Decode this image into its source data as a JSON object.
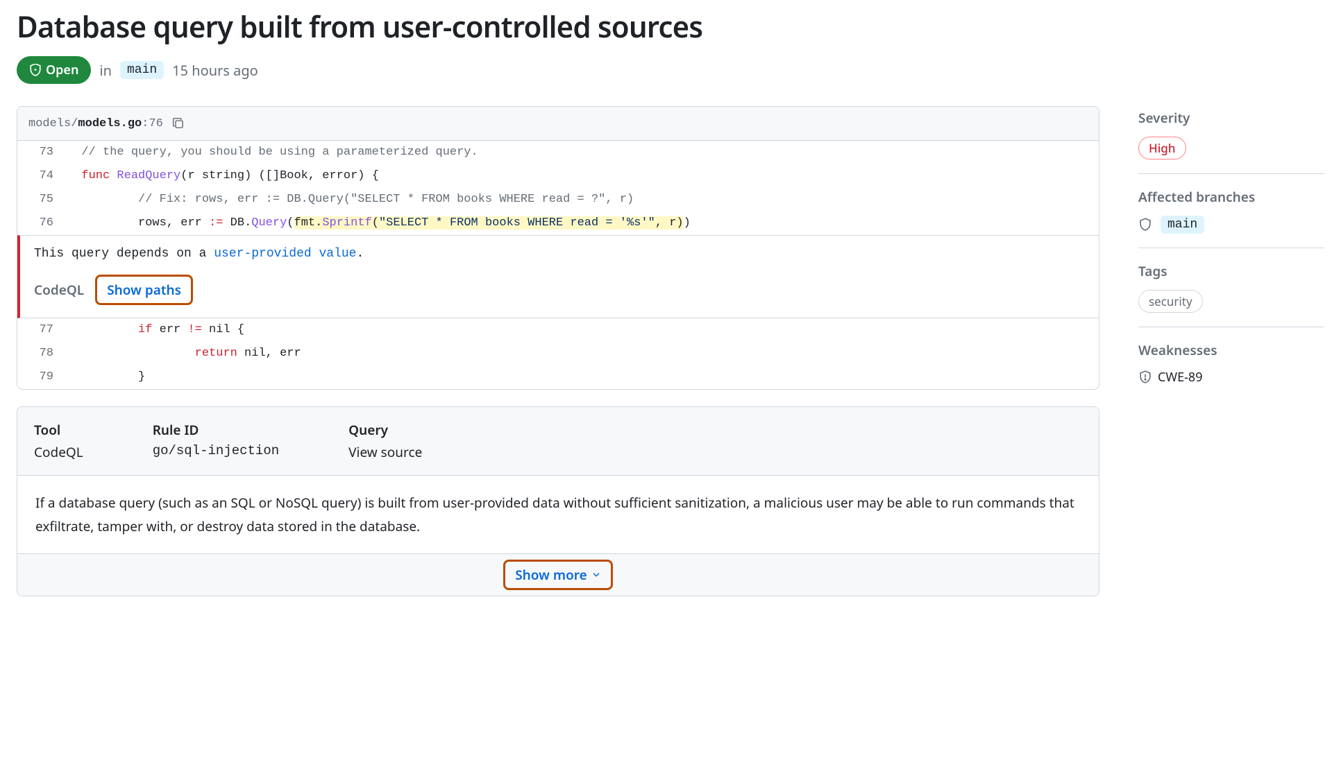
{
  "title": "Database query built from user-controlled sources",
  "state": {
    "label": "Open"
  },
  "meta": {
    "in_label": "in",
    "branch": "main",
    "time": "15 hours ago"
  },
  "file": {
    "path_dir": "models/",
    "path_file": "models.go",
    "path_line": ":76"
  },
  "code": {
    "lines": [
      {
        "no": "73"
      },
      {
        "no": "74"
      },
      {
        "no": "75"
      },
      {
        "no": "76"
      },
      {
        "no": "77"
      },
      {
        "no": "78"
      },
      {
        "no": "79"
      }
    ],
    "l73_comment": "// the query, you should be using a parameterized query.",
    "l74_func": "func",
    "l74_name": " ReadQuery",
    "l74_sig": "(r string) ([]Book, error) {",
    "l75_comment": "// Fix: rows, err := DB.Query(\"SELECT * FROM books WHERE read = ?\", r)",
    "l76_pre": "rows, err ",
    "l76_op": ":=",
    "l76_db": " DB.",
    "l76_query": "Query",
    "l76_open": "(",
    "l76_fmt": "fmt",
    "l76_dot": ".",
    "l76_sprintf": "Sprintf",
    "l76_open2": "(",
    "l76_str": "\"SELECT * FROM books WHERE read = '%s'\"",
    "l76_rest": ", r)",
    "l76_close": ")",
    "l77_if": "if",
    "l77_rest": " err ",
    "l77_op": "!=",
    "l77_nil": " nil {",
    "l78_return": "return",
    "l78_rest": " nil, err",
    "l79": "}"
  },
  "alert": {
    "msg_pre": "This query depends on a ",
    "msg_link": "user-provided value",
    "msg_post": ".",
    "codeql": "CodeQL",
    "show_paths": "Show paths"
  },
  "rule": {
    "tool_label": "Tool",
    "tool_value": "CodeQL",
    "ruleid_label": "Rule ID",
    "ruleid_value": "go/sql-injection",
    "query_label": "Query",
    "query_value": "View source"
  },
  "description": "If a database query (such as an SQL or NoSQL query) is built from user-provided data without sufficient sanitization, a malicious user may be able to run commands that exfiltrate, tamper with, or destroy data stored in the database.",
  "show_more": "Show more",
  "sidebar": {
    "severity_label": "Severity",
    "severity_value": "High",
    "branches_label": "Affected branches",
    "branches_value": "main",
    "tags_label": "Tags",
    "tags_value": "security",
    "weaknesses_label": "Weaknesses",
    "weaknesses_value": "CWE-89"
  }
}
